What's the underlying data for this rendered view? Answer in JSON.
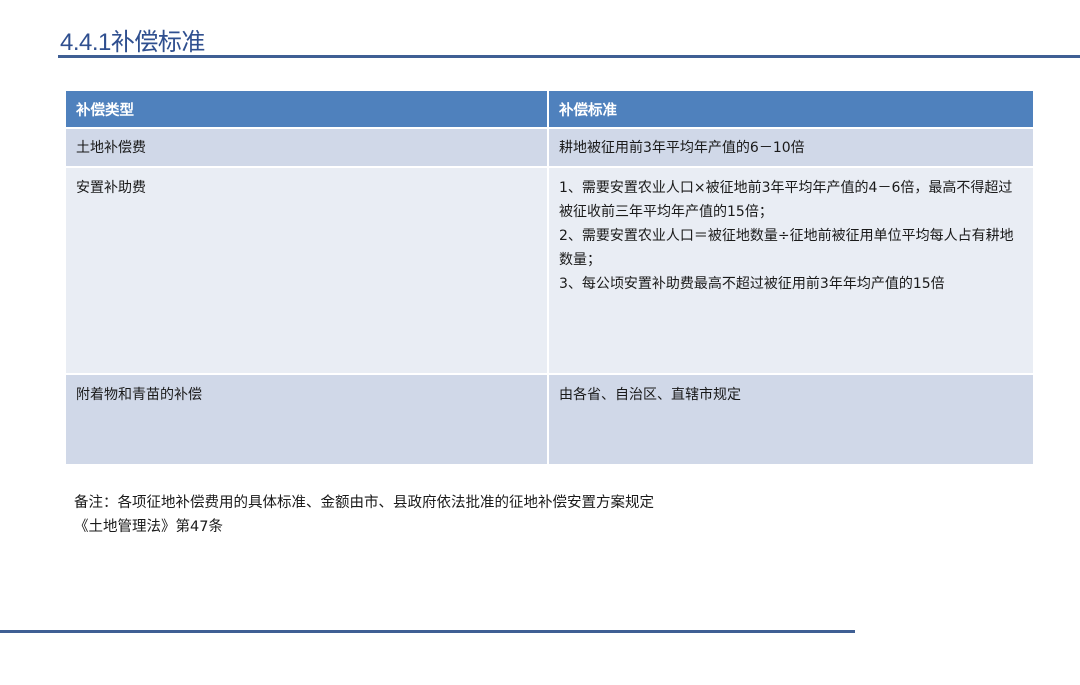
{
  "title": "4.4.1补偿标准",
  "table": {
    "headers": [
      "补偿类型",
      "补偿标准"
    ],
    "rows": [
      {
        "type": "土地补偿费",
        "standard": [
          "耕地被征用前3年平均年产值的6－10倍"
        ]
      },
      {
        "type": "安置补助费",
        "standard": [
          "1、需要安置农业人口×被征地前3年平均年产值的4－6倍，最高不得超过被征收前三年平均年产值的15倍；",
          "2、需要安置农业人口＝被征地数量÷征地前被征用单位平均每人占有耕地数量；",
          "3、每公顷安置补助费最高不超过被征用前3年年均产值的15倍"
        ]
      },
      {
        "type": "附着物和青苗的补偿",
        "standard": [
          "由各省、自治区、直辖市规定"
        ]
      }
    ]
  },
  "notes": {
    "line1": "备注：各项征地补偿费用的具体标准、金额由市、县政府依法批准的征地补偿安置方案规定",
    "line2": "《土地管理法》第47条"
  }
}
